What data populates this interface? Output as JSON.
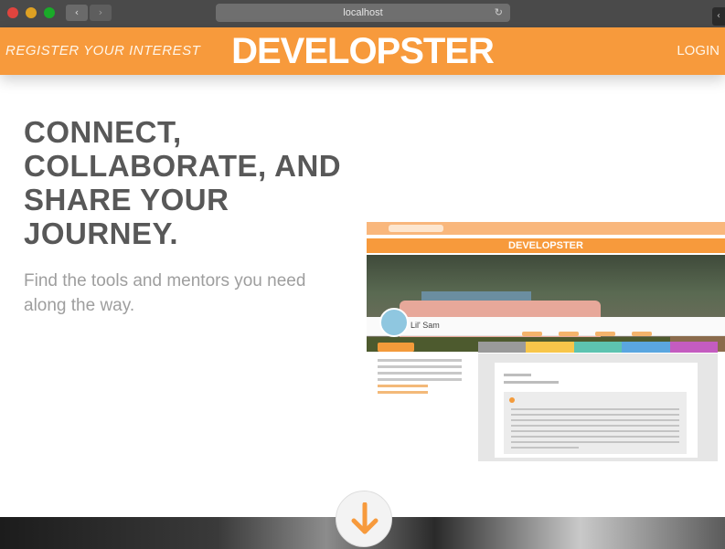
{
  "browser": {
    "url": "localhost",
    "back_icon": "chevron-left-icon",
    "forward_icon": "chevron-right-icon",
    "reload_icon": "reload-icon"
  },
  "header": {
    "register_label": "REGISTER YOUR INTEREST",
    "logo_text": "DEVELOPSTER",
    "login_label": "LOGIN",
    "brand_color": "#f79a3c"
  },
  "hero": {
    "headline": "CONNECT, COLLABORATE, AND SHARE YOUR JOURNEY.",
    "tagline": "Find the tools and mentors you need along the way."
  },
  "preview": {
    "logo_text": "DEVELOPSTER",
    "profile_name": "Lil' Sam",
    "tab_colors": [
      "#9a9a9a",
      "#f7c64a",
      "#5dc3b0",
      "#5aa6e0",
      "#c45cc0"
    ]
  },
  "scroll_button": {
    "icon": "arrow-down-icon",
    "color": "#f79a3c"
  }
}
